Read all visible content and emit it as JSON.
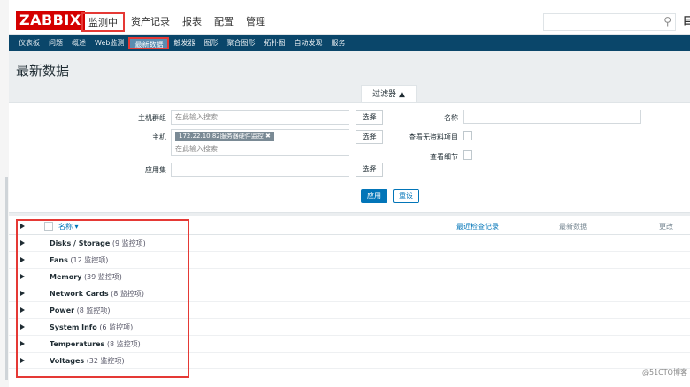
{
  "header": {
    "logo": "ZABBIX",
    "nav": [
      "监测中",
      "资产记录",
      "报表",
      "配置",
      "管理"
    ],
    "search_icon": "search-icon",
    "help": "目"
  },
  "subnav": [
    "仪表板",
    "问题",
    "概述",
    "Web监测",
    "最新数据",
    "触发器",
    "图形",
    "聚合图形",
    "拓扑图",
    "自动发现",
    "服务"
  ],
  "page_title": "最新数据",
  "filter": {
    "tab_label": "过滤器 ▲",
    "host_group_label": "主机群组",
    "host_group_placeholder": "在此输入搜索",
    "host_label": "主机",
    "host_tag": "172.22.10.82服务器硬件监控 ✖",
    "host_placeholder": "在此输入搜索",
    "app_label": "应用集",
    "select_button": "选择",
    "name_label": "名称",
    "show_no_data_label": "查看无资料项目",
    "show_details_label": "查看细节",
    "apply_button": "应用",
    "reset_button": "重设"
  },
  "table": {
    "col_name": "名称 ▾",
    "col_last_check": "最近检查记录",
    "col_last_value": "最新数据",
    "col_change": "更改",
    "rows": [
      {
        "name": "Disks / Storage",
        "count": "(9 监控项)"
      },
      {
        "name": "Fans",
        "count": "(12 监控项)"
      },
      {
        "name": "Memory",
        "count": "(39 监控项)"
      },
      {
        "name": "Network Cards",
        "count": "(8 监控项)"
      },
      {
        "name": "Power",
        "count": "(8 监控项)"
      },
      {
        "name": "System Info",
        "count": "(6 监控项)"
      },
      {
        "name": "Temperatures",
        "count": "(8 监控项)"
      },
      {
        "name": "Voltages",
        "count": "(32 监控项)"
      }
    ]
  },
  "watermark": "@51CTO博客"
}
